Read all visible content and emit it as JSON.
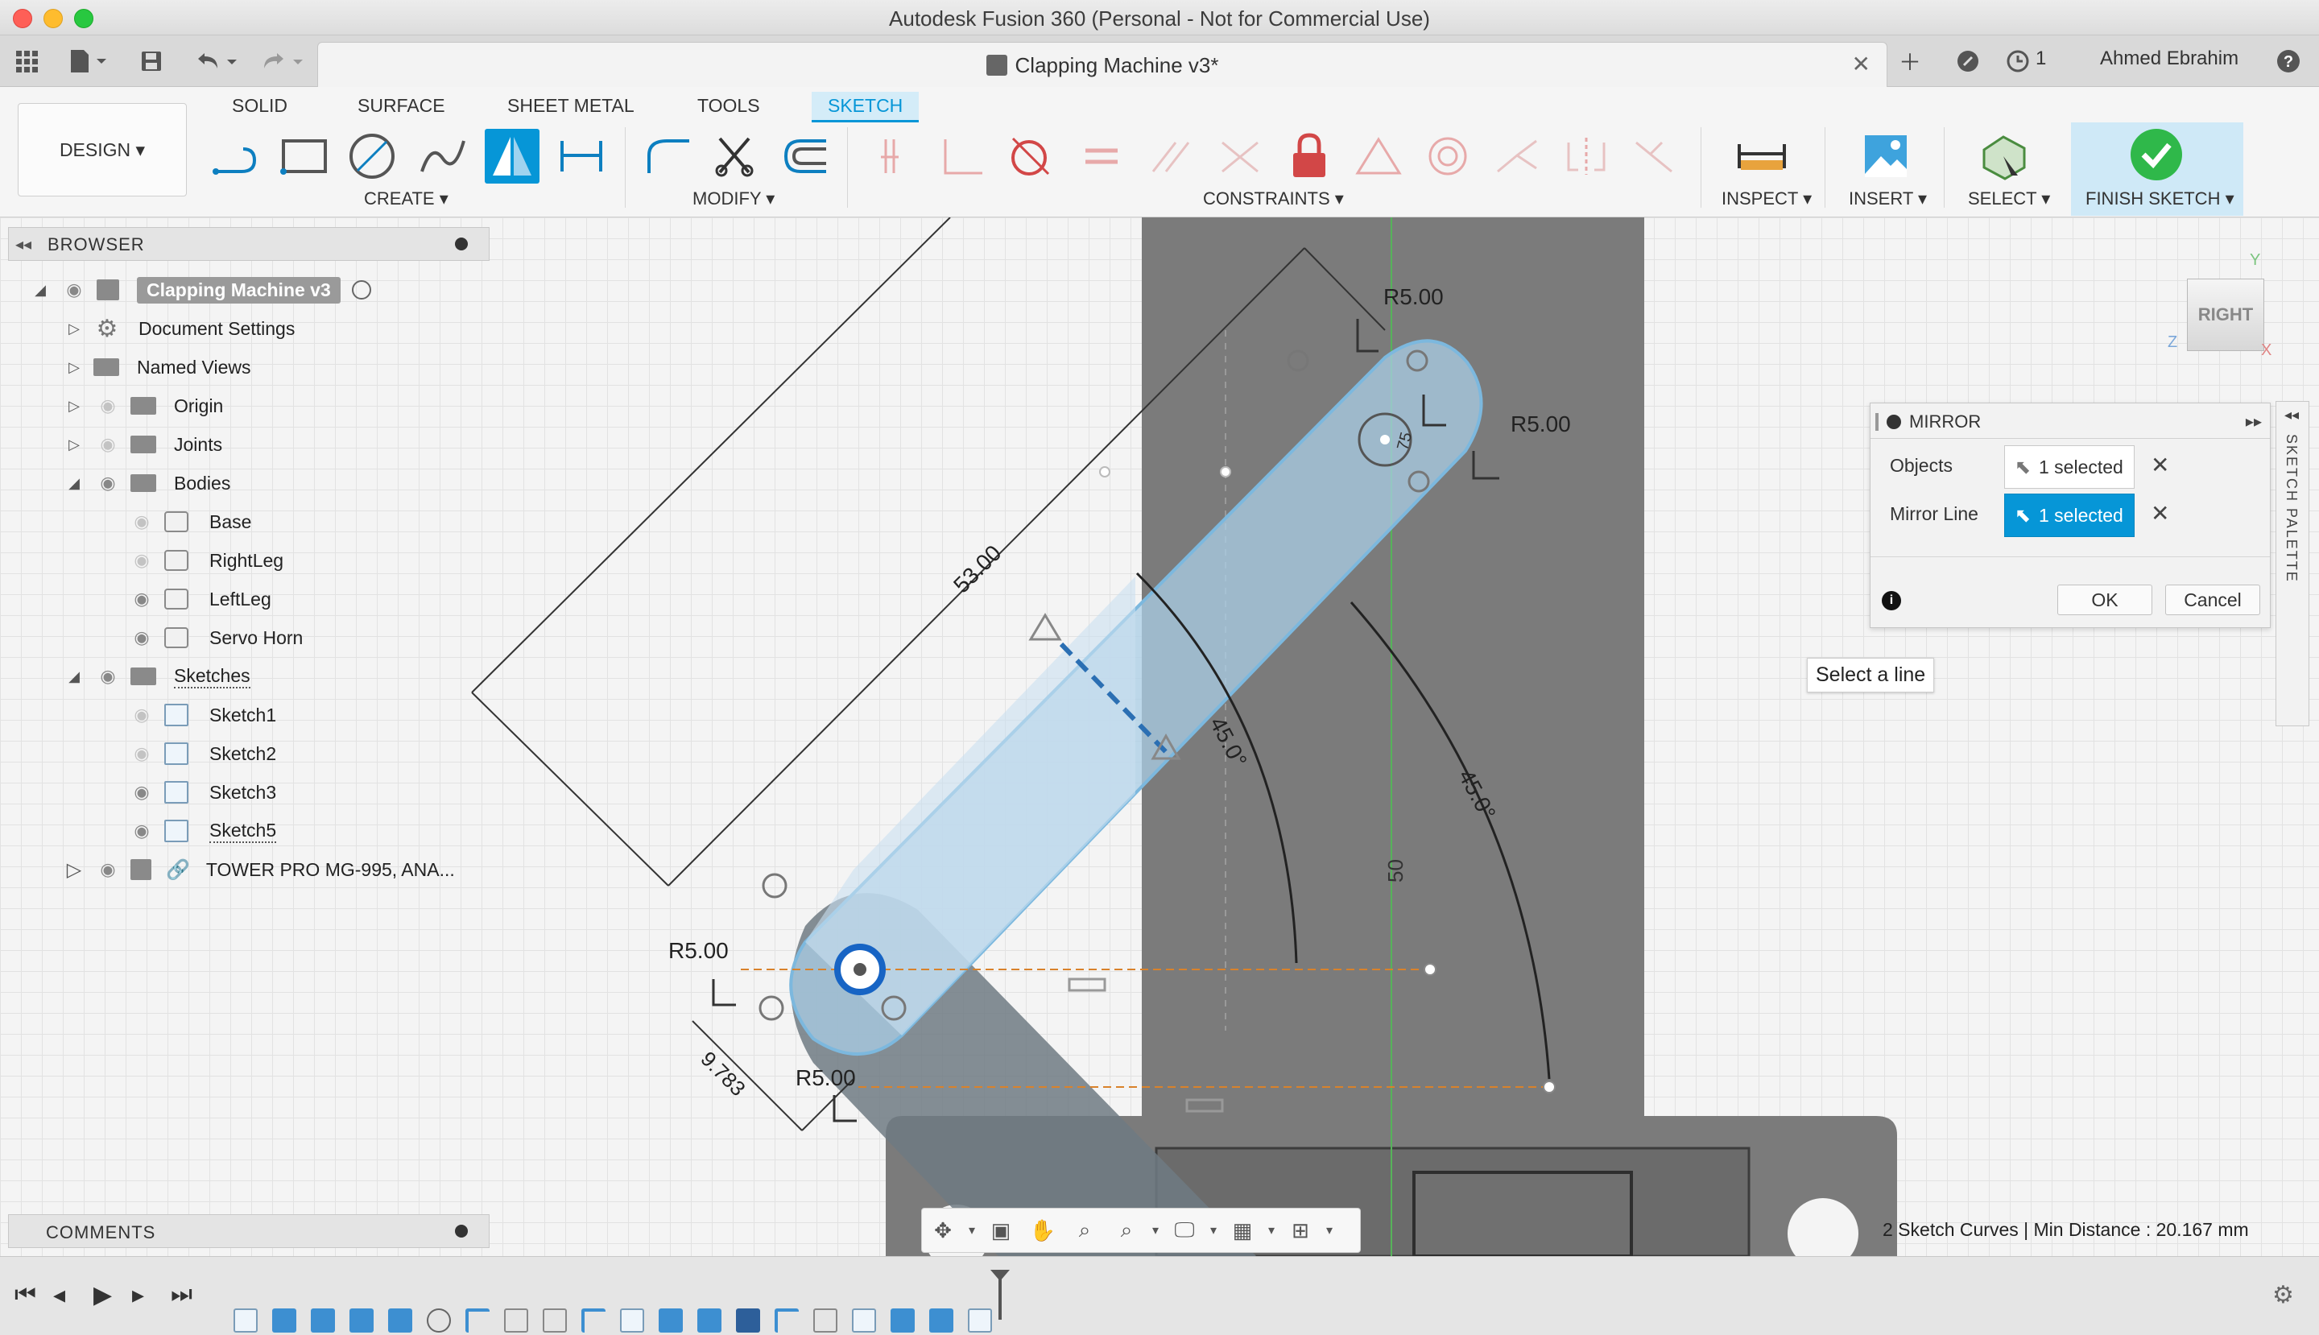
{
  "window": {
    "title": "Autodesk Fusion 360 (Personal - Not for Commercial Use)"
  },
  "doc_tab": {
    "title": "Clapping Machine v3*",
    "close": "✕"
  },
  "account": {
    "jobs_count": "1",
    "user_name": "Ahmed Ebrahim",
    "help": "?"
  },
  "toolbar": {
    "workspace": "DESIGN ▾",
    "tabs": [
      "SOLID",
      "SURFACE",
      "SHEET METAL",
      "TOOLS",
      "SKETCH"
    ],
    "groups": {
      "create": "CREATE ▾",
      "modify": "MODIFY ▾",
      "constraints": "CONSTRAINTS ▾",
      "inspect": "INSPECT ▾",
      "insert": "INSERT ▾",
      "select": "SELECT ▾",
      "finish": "FINISH SKETCH ▾"
    }
  },
  "browser": {
    "title": "BROWSER",
    "root": "Clapping Machine v3",
    "items": [
      {
        "label": "Document Settings"
      },
      {
        "label": "Named Views"
      },
      {
        "label": "Origin"
      },
      {
        "label": "Joints"
      },
      {
        "label": "Bodies"
      },
      {
        "label": "Base"
      },
      {
        "label": "RightLeg"
      },
      {
        "label": "LeftLeg"
      },
      {
        "label": "Servo Horn"
      },
      {
        "label": "Sketches"
      },
      {
        "label": "Sketch1"
      },
      {
        "label": "Sketch2"
      },
      {
        "label": "Sketch3"
      },
      {
        "label": "Sketch5"
      },
      {
        "label": "TOWER PRO MG-995, ANA..."
      }
    ]
  },
  "comments": {
    "title": "COMMENTS"
  },
  "mirror_dialog": {
    "title": "MIRROR",
    "objects_label": "Objects",
    "objects_value": "1 selected",
    "mirror_line_label": "Mirror Line",
    "mirror_line_value": "1 selected",
    "ok": "OK",
    "cancel": "Cancel"
  },
  "tooltip": "Select a line",
  "sketch_palette": "SKETCH PALETTE",
  "viewcube": {
    "face": "RIGHT",
    "axis_y": "Y",
    "axis_z": "Z",
    "axis_x": "X"
  },
  "dimensions": {
    "r_top": "R5.00",
    "r_right": "R5.00",
    "r_left": "R5.00",
    "r_bottom": "R5.00",
    "length": "53.00",
    "angle1": "45.0°",
    "angle2": "45.0°",
    "width": "9.783",
    "height": "50",
    "small": "75"
  },
  "status": "2 Sketch Curves | Min Distance : 20.167 mm",
  "colors": {
    "accent": "#0696d7",
    "finish_green": "#2fb84a",
    "selection_fill": "#a9cde6",
    "gray_body": "#7b7b7b"
  }
}
